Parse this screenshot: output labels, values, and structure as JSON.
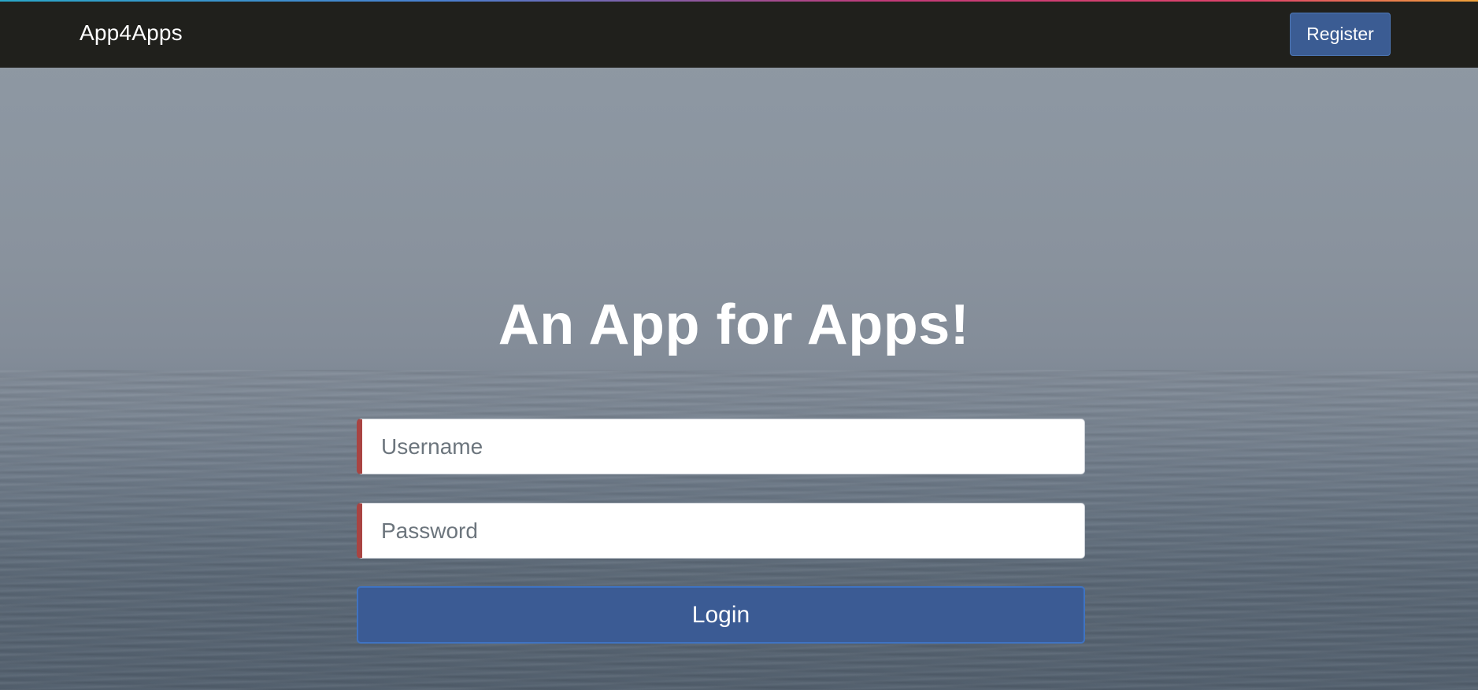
{
  "navbar": {
    "brand": "App4Apps",
    "register_label": "Register"
  },
  "hero": {
    "title": "An App for Apps!"
  },
  "login_form": {
    "username_placeholder": "Username",
    "username_value": "",
    "password_placeholder": "Password",
    "password_value": "",
    "login_label": "Login"
  },
  "colors": {
    "navbar_bg": "#20201c",
    "primary_button": "#3b5b94",
    "invalid_field_marker": "#a94442"
  }
}
